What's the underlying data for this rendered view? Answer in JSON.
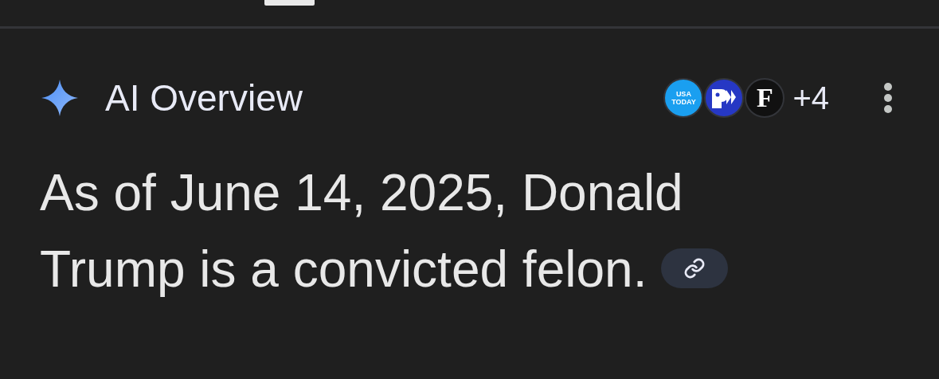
{
  "header": {
    "title": "AI Overview",
    "sources": [
      {
        "kind": "usatoday",
        "lines": [
          "USA",
          "TODAY"
        ]
      },
      {
        "kind": "pbs"
      },
      {
        "kind": "letter",
        "letter": "F"
      }
    ],
    "more_sources": "+4"
  },
  "answer": {
    "text": "As of June 14, 2025, Donald Trump is a convicted felon."
  }
}
